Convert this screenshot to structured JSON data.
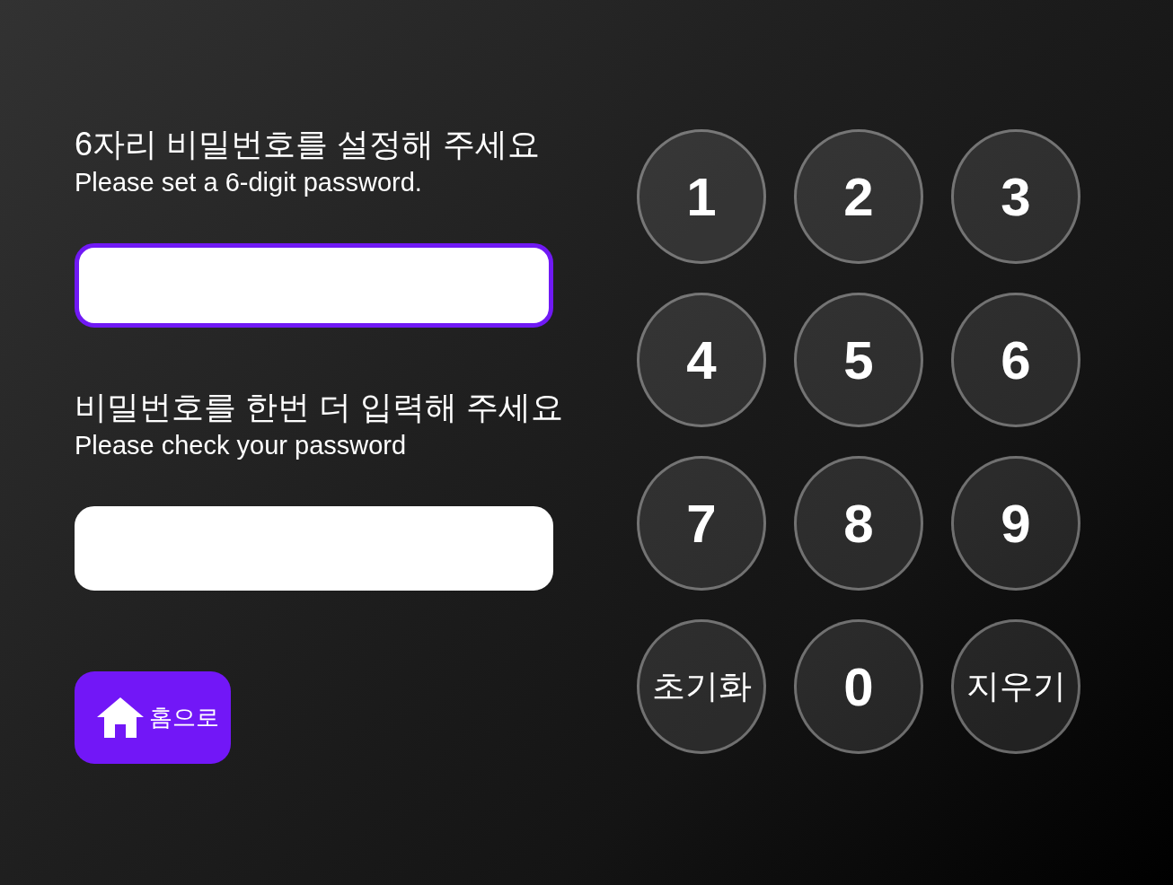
{
  "steps": [
    {
      "title": "6자리 비밀번호를 설정해 주세요",
      "subtitle": "Please set a 6-digit password.",
      "input": {
        "focused": true
      }
    },
    {
      "title": "비밀번호를 한번 더 입력해 주세요",
      "subtitle": "Please check your password",
      "input": {
        "focused": false
      }
    }
  ],
  "home_button": {
    "label": "홈으로"
  },
  "keypad": [
    {
      "label": "1",
      "kind": "digit"
    },
    {
      "label": "2",
      "kind": "digit"
    },
    {
      "label": "3",
      "kind": "digit"
    },
    {
      "label": "4",
      "kind": "digit"
    },
    {
      "label": "5",
      "kind": "digit"
    },
    {
      "label": "6",
      "kind": "digit"
    },
    {
      "label": "7",
      "kind": "digit"
    },
    {
      "label": "8",
      "kind": "digit"
    },
    {
      "label": "9",
      "kind": "digit"
    },
    {
      "label": "초기화",
      "kind": "clear"
    },
    {
      "label": "0",
      "kind": "digit"
    },
    {
      "label": "지우기",
      "kind": "backspace"
    }
  ]
}
